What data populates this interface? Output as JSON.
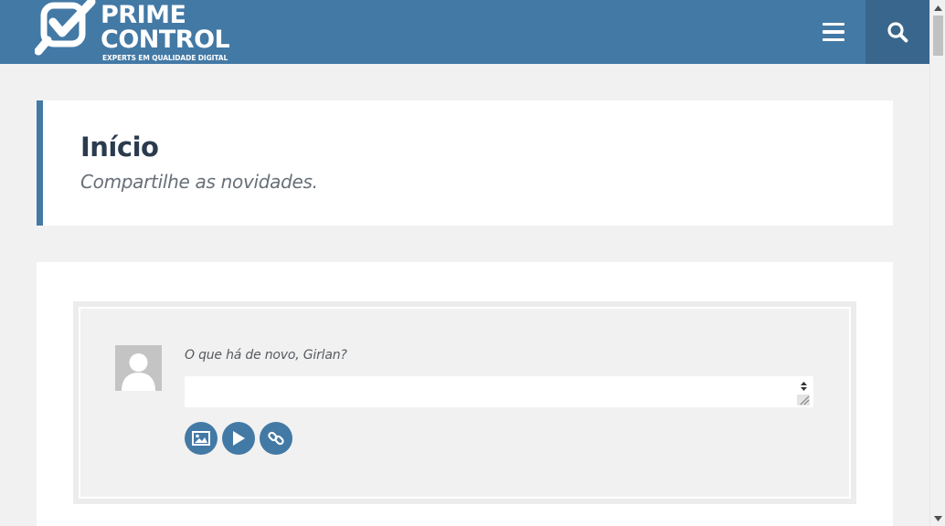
{
  "header": {
    "logo_line1": "PRIME",
    "logo_line2": "CONTROL",
    "logo_tagline": "EXPERTS EM QUALIDADE DIGITAL",
    "menu_icon": "hamburger-menu-icon",
    "search_icon": "search-icon",
    "bg_color": "#4379a5",
    "search_bg_color": "#39668c"
  },
  "page": {
    "title": "Início",
    "subtitle": "Compartilhe as novidades."
  },
  "post_form": {
    "prompt": "O que há de novo, Girlan?",
    "input_value": "",
    "actions": [
      {
        "icon": "image-icon"
      },
      {
        "icon": "play-icon"
      },
      {
        "icon": "link-icon"
      }
    ]
  },
  "colors": {
    "accent": "#4379a5",
    "title": "#2b3b4e",
    "background": "#f1f1f1"
  }
}
